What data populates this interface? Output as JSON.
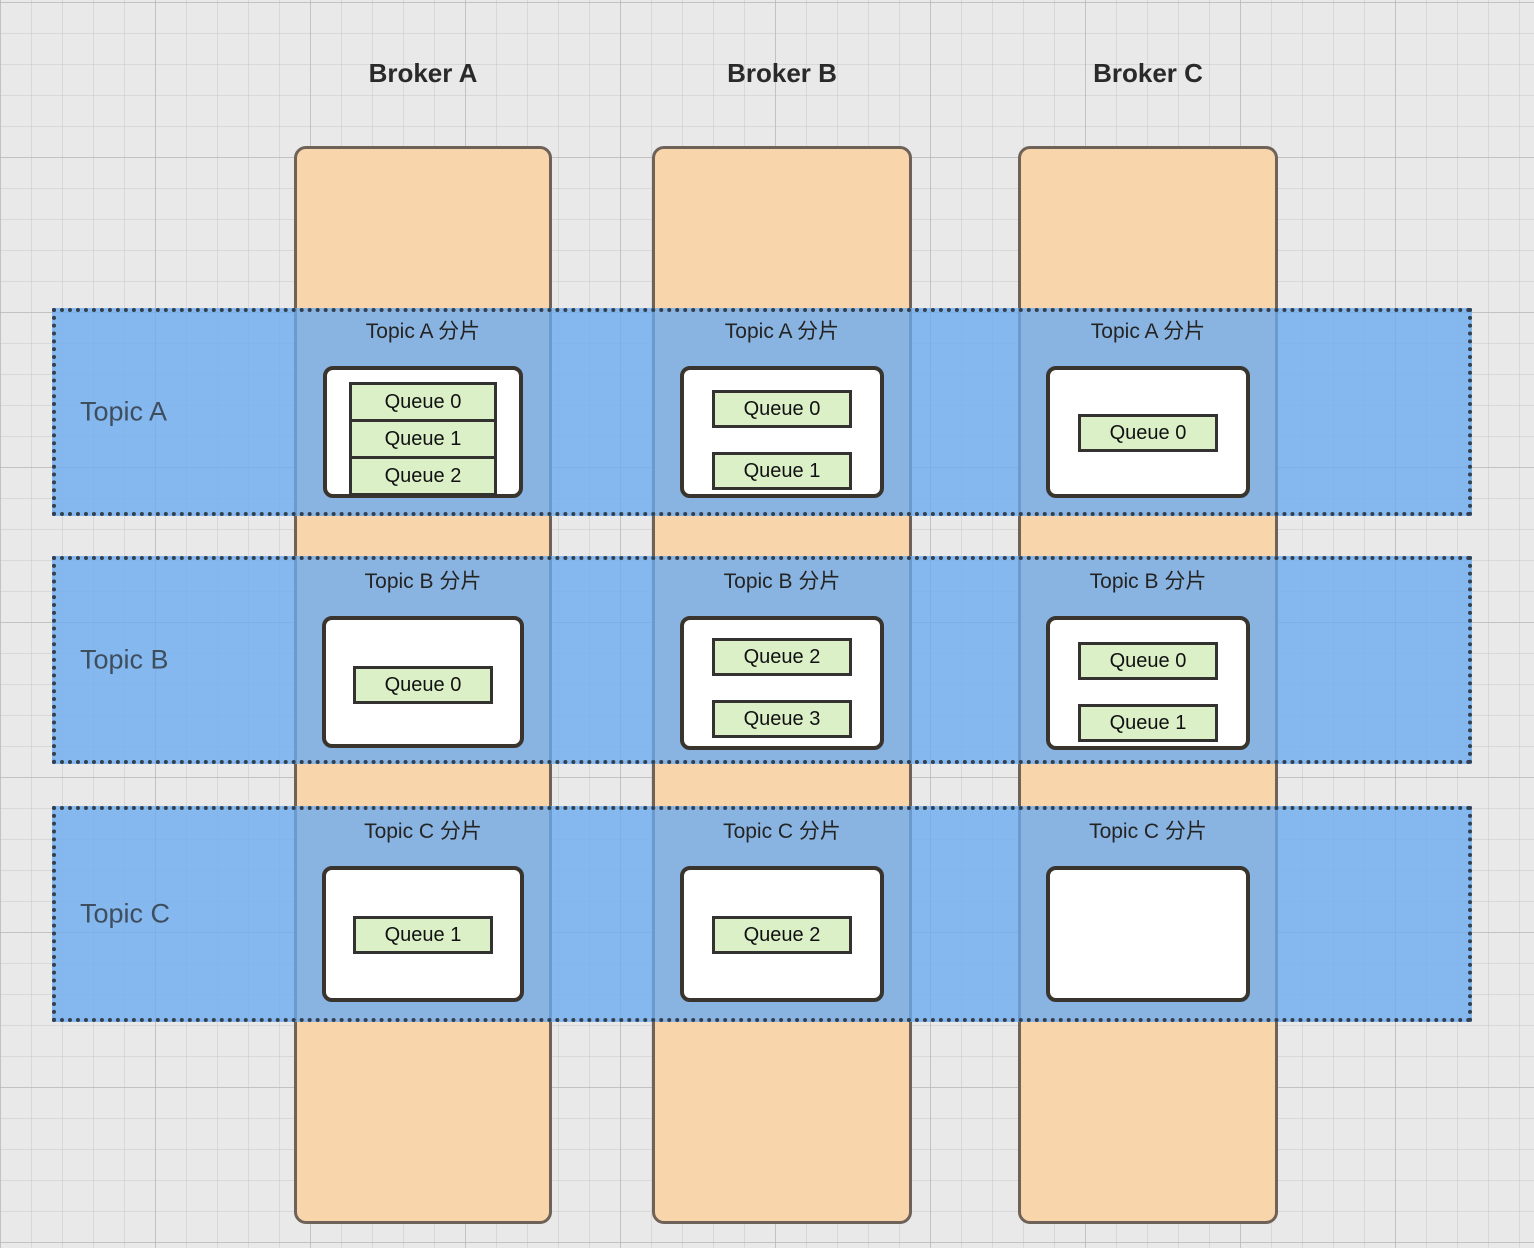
{
  "diagram": {
    "title": "Broker topic shard queue distribution",
    "colors": {
      "broker_fill": "#f9d5ac",
      "broker_border": "#6f6259",
      "topic_band_fill": "#69aaf0",
      "topic_band_border": "#33404f",
      "topic_label_text": "#3e4e5e",
      "queue_fill": "#dcf0c8",
      "queue_border": "#333230",
      "shard_box_fill": "#ffffff",
      "shard_box_border": "#3a342e",
      "background": "#e9e9e9"
    }
  },
  "brokers": [
    {
      "id": "broker-a",
      "label": "Broker A"
    },
    {
      "id": "broker-b",
      "label": "Broker B"
    },
    {
      "id": "broker-c",
      "label": "Broker C"
    }
  ],
  "topics": [
    {
      "id": "topic-a",
      "label": "Topic A"
    },
    {
      "id": "topic-b",
      "label": "Topic B"
    },
    {
      "id": "topic-c",
      "label": "Topic C"
    }
  ],
  "shards": [
    {
      "id": "shard-a-a",
      "topic": "Topic A",
      "broker": "Broker A",
      "title": "Topic A 分片",
      "queues": [
        "Queue 0",
        "Queue 1",
        "Queue 2"
      ]
    },
    {
      "id": "shard-a-b",
      "topic": "Topic A",
      "broker": "Broker B",
      "title": "Topic A 分片",
      "queues": [
        "Queue 0",
        "Queue 1"
      ]
    },
    {
      "id": "shard-a-c",
      "topic": "Topic A",
      "broker": "Broker C",
      "title": "Topic A 分片",
      "queues": [
        "Queue 0"
      ]
    },
    {
      "id": "shard-b-a",
      "topic": "Topic B",
      "broker": "Broker A",
      "title": "Topic B 分片",
      "queues": [
        "Queue 0"
      ]
    },
    {
      "id": "shard-b-b",
      "topic": "Topic B",
      "broker": "Broker B",
      "title": "Topic B 分片",
      "queues": [
        "Queue 2",
        "Queue 3"
      ]
    },
    {
      "id": "shard-b-c",
      "topic": "Topic B",
      "broker": "Broker C",
      "title": "Topic B 分片",
      "queues": [
        "Queue 0",
        "Queue 1"
      ]
    },
    {
      "id": "shard-c-a",
      "topic": "Topic C",
      "broker": "Broker A",
      "title": "Topic C 分片",
      "queues": [
        "Queue 1"
      ]
    },
    {
      "id": "shard-c-b",
      "topic": "Topic C",
      "broker": "Broker B",
      "title": "Topic C 分片",
      "queues": [
        "Queue 2"
      ]
    },
    {
      "id": "shard-c-c",
      "topic": "Topic C",
      "broker": "Broker C",
      "title": "Topic C 分片",
      "queues": []
    }
  ]
}
